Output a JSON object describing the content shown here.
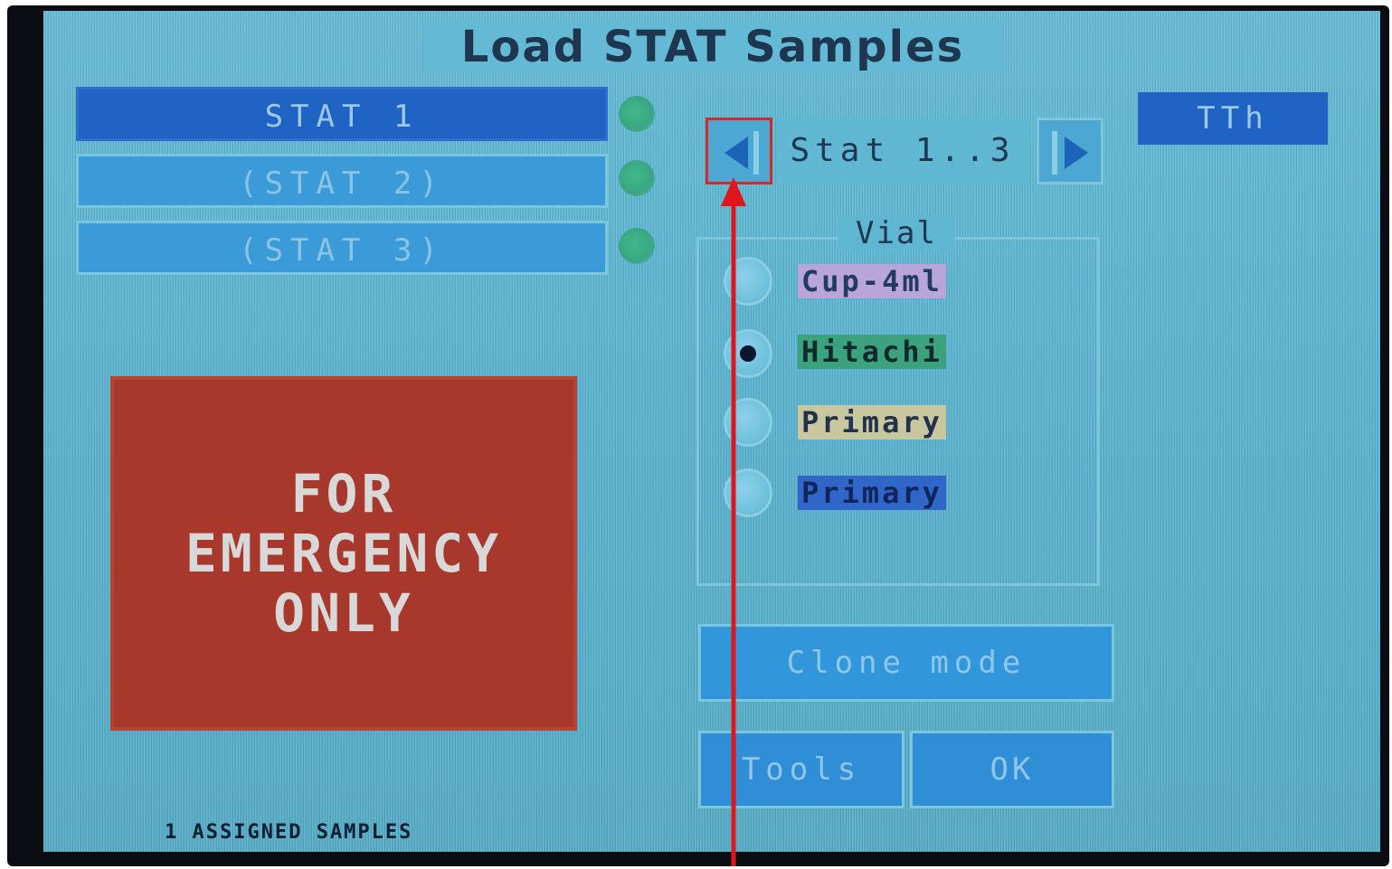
{
  "title": "Load STAT Samples",
  "stat_list": [
    {
      "label": "STAT 1",
      "selected": true
    },
    {
      "label": "(STAT 2)",
      "selected": false
    },
    {
      "label": "(STAT 3)",
      "selected": false
    }
  ],
  "navigator": {
    "range_label": "Stat 1..3",
    "prev_icon": "triangle-left-icon",
    "next_icon": "triangle-right-icon"
  },
  "tth_button": {
    "label": "TTh"
  },
  "vial": {
    "group_label": "Vial",
    "options": [
      {
        "label": "Cup-4ml",
        "selected": false,
        "color": "#b8a6d8"
      },
      {
        "label": "Hitachi",
        "selected": true,
        "color": "#3ca27e"
      },
      {
        "label": "Primary",
        "selected": false,
        "color": "#c9c79d"
      },
      {
        "label": "Primary",
        "selected": false,
        "color": "#2f66c8"
      }
    ]
  },
  "buttons": {
    "clone": "Clone mode",
    "tools": "Tools",
    "ok": "OK"
  },
  "emergency_sign": {
    "lines": [
      "FOR",
      "EMERGENCY",
      "ONLY"
    ],
    "color": "#a8382c"
  },
  "status": "1 ASSIGNED SAMPLES",
  "annotation": {
    "color": "#e0161b"
  }
}
